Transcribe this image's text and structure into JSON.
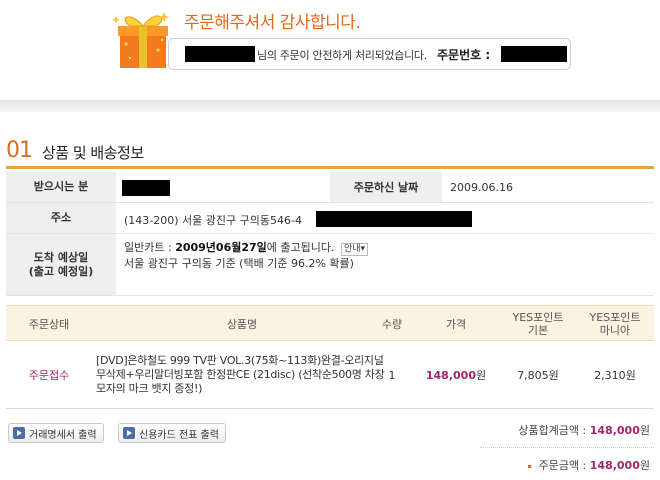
{
  "header": {
    "thanks_text": "주문해주셔서 감사합니다.",
    "order_message": "님의 주문이 안전하게 처리되었습니다.",
    "order_number_label": "주문번호 :"
  },
  "section": {
    "number": "01",
    "title": "상품 및 배송정보"
  },
  "info": {
    "recipient_label": "받으시는 분",
    "order_date_label": "주문하신 날짜",
    "order_date": "2009.06.16",
    "address_label": "주소",
    "address": "(143-200) 서울 광진구 구의동546-4",
    "arrival_label_1": "도착 예상일",
    "arrival_label_2": "(출고 예정일)",
    "ship_prefix": "일반카트 :",
    "ship_date": "2009년06월27일",
    "ship_suffix": "에 출고됩니다.",
    "guide_button": "안내▾",
    "ship_note": "서울 광진구 구의동 기준 (택배 기준 96.2% 확률)"
  },
  "table": {
    "headers": [
      "주문상태",
      "상품명",
      "수량",
      "가격",
      "YES포인트\n기본",
      "YES포인트\n마니아"
    ],
    "rows": [
      {
        "status": "주문접수",
        "name": "[DVD]은하철도 999 TV판 VOL.3(75화~113화)완결-오리지널 무삭제+우리말더빙포함 한정판CE (21disc) (선착순500명 차장 모자의 마크 뱃지 증정!)",
        "qty": "1",
        "price": "148,000",
        "price_unit": "원",
        "points_basic": "7,805원",
        "points_mania": "2,310원"
      }
    ]
  },
  "buttons": {
    "statement_print": "거래명세서 출력",
    "card_slip_print": "신용카드 전표 출력"
  },
  "totals": {
    "product_total_label": "상품합계금액 :",
    "product_total": "148,000",
    "order_total_label": "주문금액 :",
    "order_total": "148,000",
    "unit": "원"
  },
  "colors": {
    "accent_orange": "#e06a1c",
    "price_purple": "#a3246a",
    "section_line": "#f0a13b"
  }
}
